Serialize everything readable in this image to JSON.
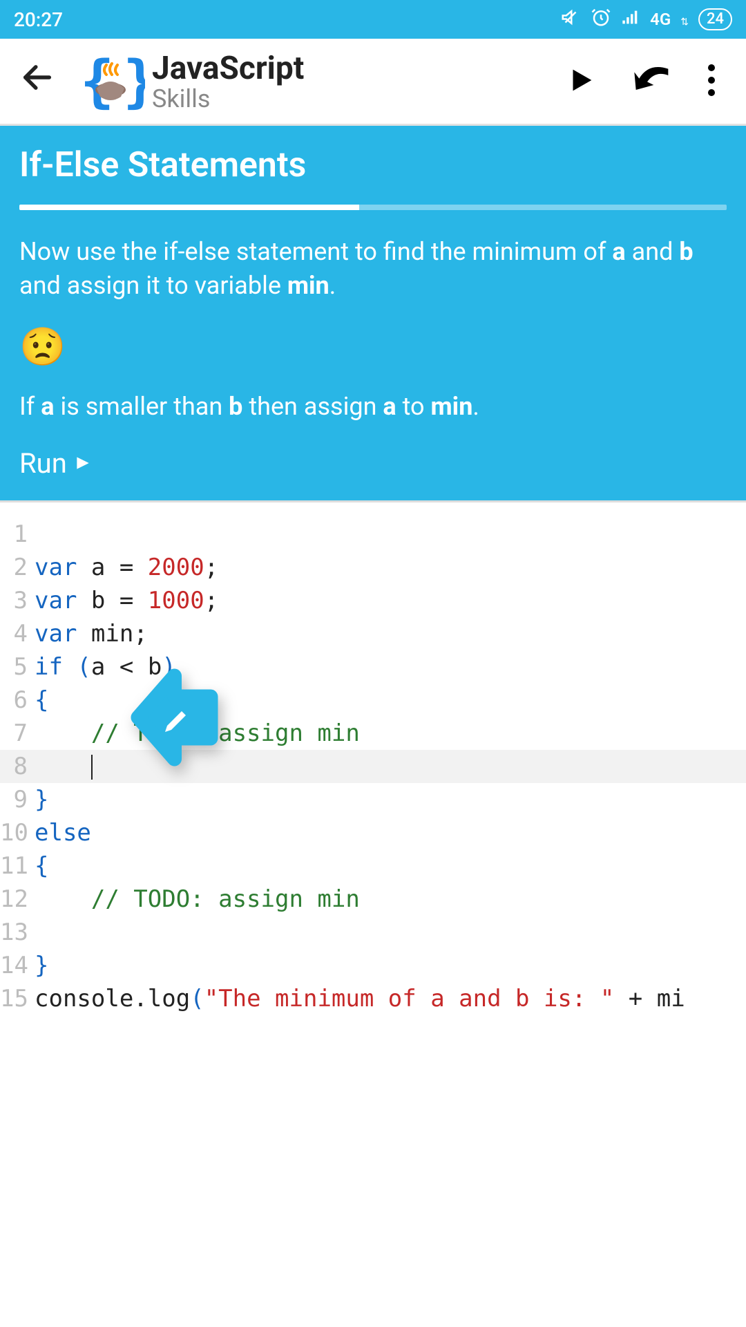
{
  "status": {
    "time": "20:27",
    "network": "4G",
    "battery": "24"
  },
  "appbar": {
    "title": "JavaScript",
    "subtitle": "Skills"
  },
  "lesson": {
    "title": "If-Else Statements",
    "progress_percent": 48,
    "text1_pre": "Now use the if-else statement to find the minimum of ",
    "text1_a": "a",
    "text1_mid": " and ",
    "text1_b": "b",
    "text1_post": " and assign it to variable ",
    "text1_min": "min",
    "text1_end": ".",
    "hint_pre": "If ",
    "hint_a": "a",
    "hint_mid1": " is smaller than ",
    "hint_b": "b",
    "hint_mid2": " then assign ",
    "hint_a2": "a",
    "hint_mid3": " to ",
    "hint_min": "min",
    "hint_end": ".",
    "run_label": "Run"
  },
  "code": {
    "l1": "",
    "l2_var": "var",
    "l2_id": " a ",
    "l2_eq": "=",
    "l2_num": " 2000",
    "l2_semi": ";",
    "l3_var": "var",
    "l3_id": " b ",
    "l3_eq": "=",
    "l3_num": " 1000",
    "l3_semi": ";",
    "l4_var": "var",
    "l4_id": " min",
    "l4_semi": ";",
    "l5_if": "if",
    "l5_open": " (",
    "l5_a": "a ",
    "l5_lt": "<",
    "l5_b": " b",
    "l5_close": ")",
    "l6_brace": "{",
    "l7_cm": "    // TODO: assign min",
    "l8_indent": "    ",
    "l9_brace": "}",
    "l10_else": "else",
    "l11_brace": "{",
    "l12_cm": "    // TODO: assign min",
    "l13_blank": "",
    "l14_brace": "}",
    "l15_console": "console",
    "l15_dot": ".",
    "l15_log": "log",
    "l15_open": "(",
    "l15_str": "\"The minimum of a and b is: \"",
    "l15_plus": " + ",
    "l15_mi": "mi"
  },
  "lines": [
    "1",
    "2",
    "3",
    "4",
    "5",
    "6",
    "7",
    "8",
    "9",
    "10",
    "11",
    "12",
    "13",
    "14",
    "15"
  ]
}
